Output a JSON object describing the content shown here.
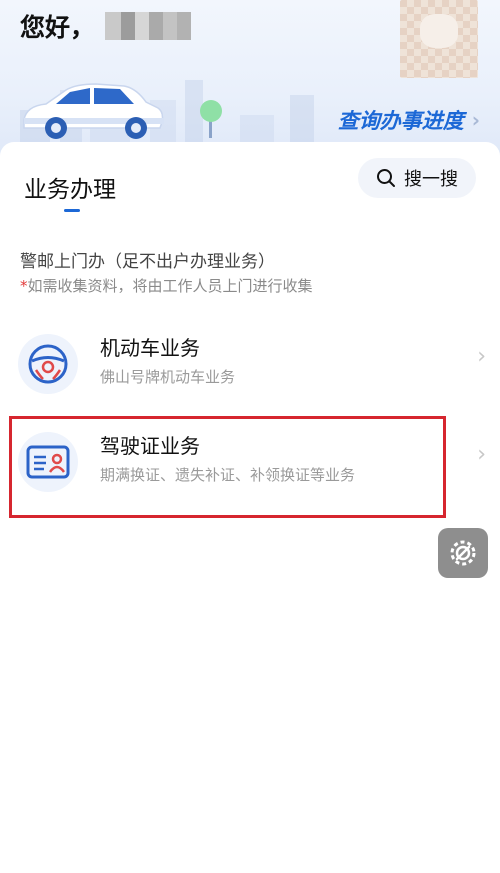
{
  "header": {
    "greeting": "您好，",
    "progress_link": "查询办事进度",
    "progress_chevron": "›"
  },
  "section": {
    "title": "业务办理",
    "search_label": "搜一搜"
  },
  "home_service": {
    "heading": "警邮上门办（足不出户办理业务）",
    "note_star": "*",
    "note": "如需收集资料，将由工作人员上门进行收集"
  },
  "services": [
    {
      "title": "机动车业务",
      "desc": "佛山号牌机动车业务",
      "icon": "steering-wheel-icon",
      "arrow": "›"
    },
    {
      "title": "驾驶证业务",
      "desc": "期满换证、遗失补证、补领换证等业务",
      "icon": "license-card-icon",
      "arrow": "›"
    }
  ],
  "colors": {
    "accent": "#1c68d6",
    "highlight": "#d6262f",
    "icon_red": "#e04a4a"
  }
}
